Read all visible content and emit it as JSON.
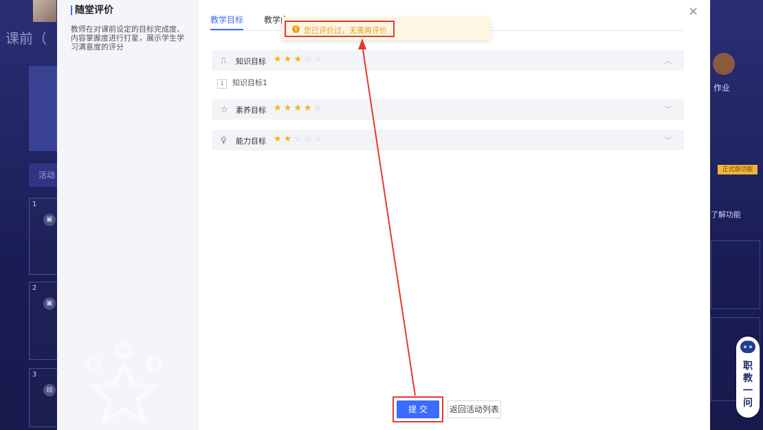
{
  "background": {
    "title": "课前（",
    "activity_label": "活动",
    "cards": [
      "1",
      "2",
      "3"
    ],
    "homework_label": "作业",
    "pro_badge": "正式版功能",
    "learn_text": "了解功能",
    "assistant_text": "职教一问"
  },
  "modal": {
    "title": "随堂评价",
    "description": "教师在对课前设定的目标完成度、内容掌握度进行打星，展示学生学习满意度的评分",
    "close_symbol": "×",
    "tabs": [
      {
        "label": "教学目标",
        "active": true
      },
      {
        "label": "教学内",
        "active": false
      }
    ],
    "toast": {
      "text": "您已评价过，无需再评价",
      "icon": "warning-icon"
    },
    "sections": [
      {
        "label": "知识目标",
        "icon": "book-icon",
        "rating": 3,
        "max": 5,
        "expanded": true
      },
      {
        "label": "素养目标",
        "icon": "star-outline-icon",
        "rating": 4,
        "max": 5,
        "expanded": false
      },
      {
        "label": "能力目标",
        "icon": "bulb-icon",
        "rating": 2,
        "max": 5,
        "expanded": false
      }
    ],
    "sub_items": [
      {
        "num": "1",
        "text": "知识目标1"
      }
    ],
    "submit_label": "提 交",
    "back_label": "返回活动列表"
  },
  "colors": {
    "accent": "#3b6cff",
    "star": "#f5b21b",
    "highlight": "#e8372c",
    "warning": "#e69b12"
  }
}
